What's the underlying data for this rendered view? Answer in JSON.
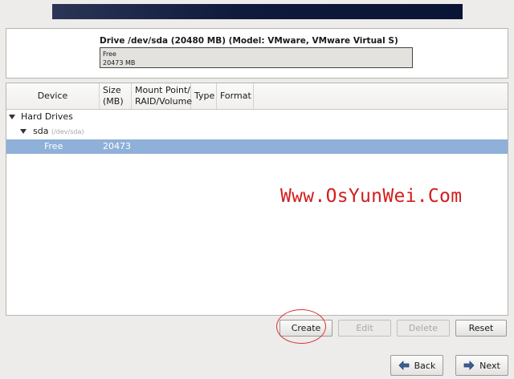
{
  "drive": {
    "title": "Drive /dev/sda (20480 MB) (Model: VMware, VMware Virtual S)",
    "bar_label": "Free",
    "bar_size": "20473 MB"
  },
  "table": {
    "columns": [
      "Device",
      "Size (MB)",
      "Mount Point/ RAID/Volume",
      "Type",
      "Format"
    ],
    "rows": {
      "group": {
        "label": "Hard Drives"
      },
      "disk": {
        "label": "sda",
        "path": "(/dev/sda)"
      },
      "free": {
        "device": "Free",
        "size": "20473"
      }
    }
  },
  "watermark": "Www.OsYunWei.Com",
  "buttons": {
    "create": "Create",
    "edit": "Edit",
    "delete": "Delete",
    "reset": "Reset",
    "back": "Back",
    "next": "Next"
  },
  "colors": {
    "selection": "#8fb0d8",
    "watermark": "#d21e1e",
    "annotation_ring": "#d93434"
  },
  "icons": {
    "back": "left-arrow-icon",
    "next": "right-arrow-icon",
    "expander": "triangle-down-icon"
  }
}
